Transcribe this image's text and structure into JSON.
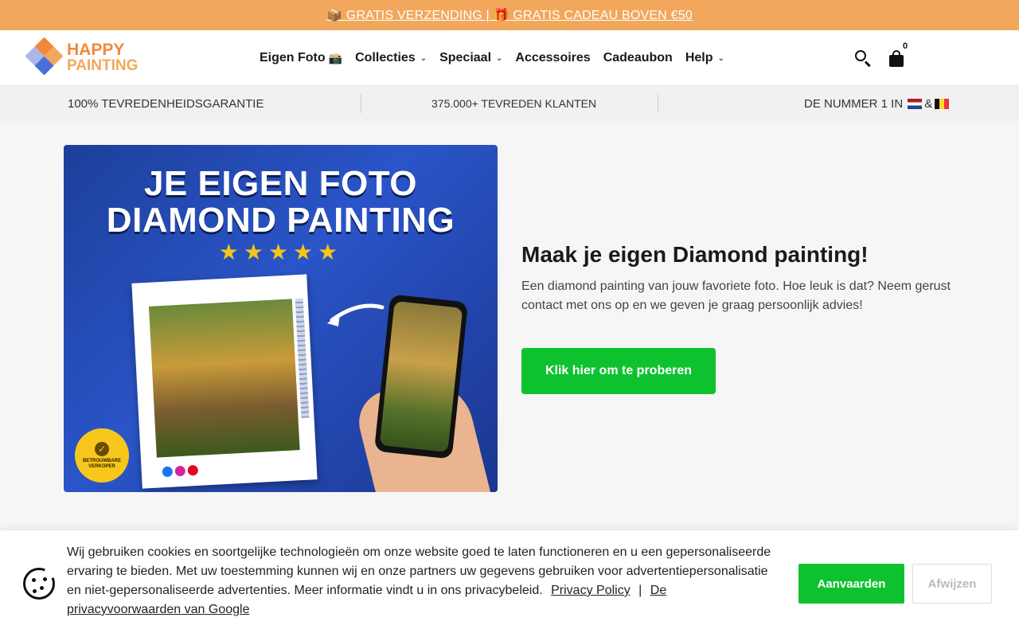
{
  "announcement": {
    "text": "📦 GRATIS VERZENDING | 🎁 GRATIS CADEAU BOVEN €50"
  },
  "header": {
    "logo": {
      "line1": "HAPPY",
      "line2": "PAINTING"
    },
    "nav": [
      {
        "label": "Eigen Foto",
        "emoji": "📸",
        "dropdown": false
      },
      {
        "label": "Collecties",
        "dropdown": true
      },
      {
        "label": "Speciaal",
        "dropdown": true
      },
      {
        "label": "Accessoires",
        "dropdown": false
      },
      {
        "label": "Cadeaubon",
        "dropdown": false
      },
      {
        "label": "Help",
        "dropdown": true
      }
    ],
    "cart_count": "0",
    "icons": {
      "search": "search-icon",
      "cart": "shopping-bag-icon",
      "chevron": "chevron-down-icon"
    }
  },
  "usp": {
    "item1": "100% TEVREDENHEIDSGARANTIE",
    "item2": "375.000+ TEVREDEN KLANTEN",
    "item3_prefix": "DE NUMMER 1 IN",
    "item3_amp": "&"
  },
  "hero": {
    "image": {
      "title_line1": "JE EIGEN FOTO",
      "title_line2": "DIAMOND PAINTING",
      "stars": "★★★★★",
      "badge_text": "BETROUWBARE VERKOPER"
    },
    "heading": "Maak je eigen Diamond painting!",
    "body": "Een diamond painting van jouw favoriete foto. Hoe leuk is dat? Neem gerust contact met ons op en we geven je graag persoonlijk advies!",
    "cta": "Klik hier om te proberen"
  },
  "cookie_banner": {
    "text": "Wij gebruiken cookies en soortgelijke technologieën om onze website goed te laten functioneren en u een gepersonaliseerde ervaring te bieden. Met uw toestemming kunnen wij en onze partners uw gegevens gebruiken voor advertentiepersonalisatie en niet-gepersonaliseerde advertenties. Meer informatie vindt u in ons privacybeleid.",
    "link1": "Privacy Policy",
    "separator": "|",
    "link2": "De privacyvoorwaarden van Google",
    "accept": "Aanvaarden",
    "decline": "Afwijzen"
  },
  "colors": {
    "announcement_bg": "#f2a85c",
    "cta_green": "#0ec22f",
    "logo_orange": "#f08a3a",
    "hero_blue": "#2a55c8"
  }
}
